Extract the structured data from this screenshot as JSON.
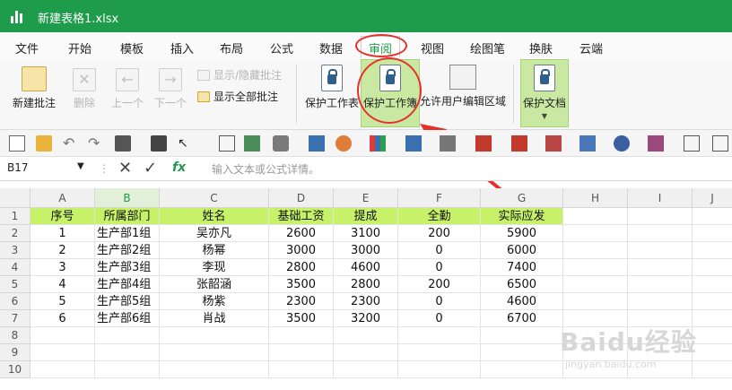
{
  "window": {
    "title": "新建表格1.xlsx"
  },
  "menu": {
    "items": [
      "文件",
      "开始",
      "模板",
      "插入",
      "布局",
      "公式",
      "数据",
      "审阅",
      "视图",
      "绘图笔",
      "换肤",
      "云端"
    ],
    "active": "审阅"
  },
  "ribbon": {
    "new_comment": "新建批注",
    "delete": "删除",
    "previous": "上一个",
    "next": "下一个",
    "show_hide_comment": "显示/隐藏批注",
    "show_all_comments": "显示全部批注",
    "protect_sheet": "保护工作表",
    "protect_workbook": "保护工作簿",
    "allow_edit_ranges": "允许用户编辑区域",
    "protect_document": "保护文档"
  },
  "formula_bar": {
    "name_box": "B17",
    "x": "✕",
    "check": "✓",
    "fx": "fx",
    "placeholder": "输入文本或公式详情。"
  },
  "sheet": {
    "columns": [
      "A",
      "B",
      "C",
      "D",
      "E",
      "F",
      "G",
      "H",
      "I",
      "J"
    ],
    "rows": [
      "1",
      "2",
      "3",
      "4",
      "5",
      "6",
      "7",
      "8",
      "9",
      "10"
    ],
    "headers": [
      "序号",
      "所属部门",
      "姓名",
      "基础工资",
      "提成",
      "全勤",
      "实际应发"
    ],
    "data": [
      [
        "1",
        "生产部1组",
        "吴亦凡",
        "2600",
        "3100",
        "200",
        "5900"
      ],
      [
        "2",
        "生产部2组",
        "杨幂",
        "3000",
        "3000",
        "0",
        "6000"
      ],
      [
        "3",
        "生产部3组",
        "李现",
        "2800",
        "4600",
        "0",
        "7400"
      ],
      [
        "4",
        "生产部4组",
        "张韶涵",
        "3500",
        "2800",
        "200",
        "6500"
      ],
      [
        "5",
        "生产部5组",
        "杨紫",
        "2300",
        "2300",
        "0",
        "4600"
      ],
      [
        "6",
        "生产部6组",
        "肖战",
        "3500",
        "3200",
        "0",
        "6700"
      ]
    ]
  },
  "watermark": {
    "text": "Baidu经验",
    "sub": "jingyan.baidu.com"
  },
  "colors": {
    "title_bar": "#1f9c4b",
    "header_fill": "#c8f16a",
    "annotation": "#e8302a",
    "highlight": "#c9e9a3"
  }
}
